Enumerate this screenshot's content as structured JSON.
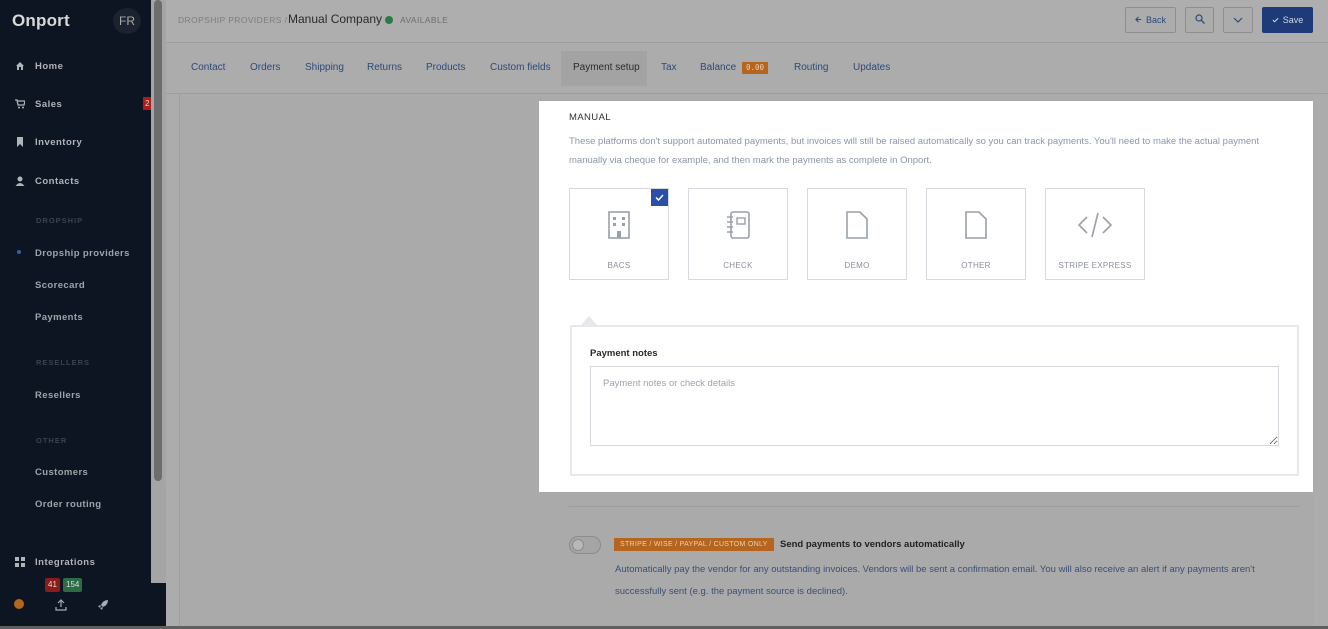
{
  "sidebar": {
    "brand": "Onport",
    "avatar": "FR",
    "items": [
      {
        "label": "Home",
        "icon": "home-icon"
      },
      {
        "label": "Sales",
        "icon": "cart-icon",
        "badge": "2"
      },
      {
        "label": "Inventory",
        "icon": "bookmark-icon"
      },
      {
        "label": "Contacts",
        "icon": "user-icon"
      }
    ],
    "sections": [
      {
        "title": "DROPSHIP",
        "items": [
          "Dropship providers",
          "Scorecard",
          "Payments"
        ]
      },
      {
        "title": "RESELLERS",
        "items": [
          "Resellers"
        ]
      },
      {
        "title": "OTHER",
        "items": [
          "Customers",
          "Order routing"
        ]
      }
    ],
    "integrations": "Integrations",
    "footer": {
      "badge_red": "41",
      "badge_green": "154"
    }
  },
  "header": {
    "breadcrumb": "DROPSHIP PROVIDERS /",
    "title": "Manual Company",
    "status": "AVAILABLE",
    "status_color": "#2b7a4b",
    "back_label": "Back",
    "save_label": "Save"
  },
  "tabs": [
    {
      "label": "Contact"
    },
    {
      "label": "Orders"
    },
    {
      "label": "Shipping"
    },
    {
      "label": "Returns"
    },
    {
      "label": "Products"
    },
    {
      "label": "Custom fields"
    },
    {
      "label": "Payment setup",
      "active": true
    },
    {
      "label": "Tax"
    },
    {
      "label": "Balance",
      "badge": "0.00"
    },
    {
      "label": "Routing"
    },
    {
      "label": "Updates"
    }
  ],
  "manual": {
    "title": "MANUAL",
    "description": "These platforms don't support automated payments, but invoices will still be raised automatically so you can track payments. You'll need to make the actual payment manually via cheque for example, and then mark the payments as complete in Onport.",
    "methods": [
      {
        "label": "BACS",
        "icon": "building-icon",
        "selected": true
      },
      {
        "label": "CHECK",
        "icon": "notebook-icon",
        "selected": false
      },
      {
        "label": "DEMO",
        "icon": "file-icon",
        "selected": false
      },
      {
        "label": "OTHER",
        "icon": "file-icon",
        "selected": false
      },
      {
        "label": "STRIPE EXPRESS",
        "icon": "code-icon",
        "selected": false
      }
    ]
  },
  "notes": {
    "label": "Payment notes",
    "placeholder": "Payment notes or check details",
    "value": ""
  },
  "auto_payments": {
    "badge": "STRIPE / WISE / PAYPAL / CUSTOM ONLY",
    "title": "Send payments to vendors automatically",
    "description": "Automatically pay the vendor for any outstanding invoices. Vendors will be sent a confirmation email. You will also receive an alert if any payments aren't successfully sent (e.g. the payment source is declined).",
    "enabled": false
  },
  "colors": {
    "accent": "#2a4fa8",
    "sidebar_bg": "#0e1522",
    "badge_orange": "#b5651d"
  }
}
